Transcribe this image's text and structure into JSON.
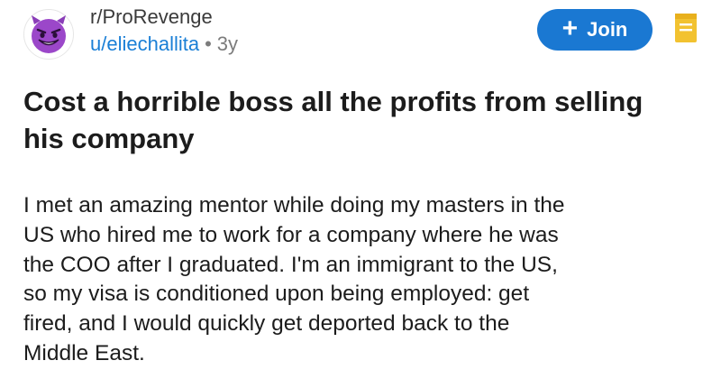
{
  "post": {
    "subreddit": "r/ProRevenge",
    "author": "u/eliechallita",
    "separator": "•",
    "age": "3y",
    "title": "Cost a horrible boss all the profits from selling his company",
    "body_lines": [
      "I met an amazing mentor while doing my masters in the",
      "US who hired me to work for a company where he was",
      "the COO after I graduated. I'm an immigrant to the US,",
      "so my visa is conditioned upon being employed: get",
      "fired, and I would quickly get deported back to the",
      "Middle East."
    ]
  },
  "actions": {
    "join_label": "Join",
    "join_icon": "plus-icon",
    "save_icon": "bookmark-icon"
  },
  "avatar_icon": "devil-face-icon",
  "colors": {
    "join_bg": "#1a78d2",
    "author": "#1a7fd6",
    "avatar_purple": "#8a3db8",
    "save_icon": "#f2c230"
  }
}
